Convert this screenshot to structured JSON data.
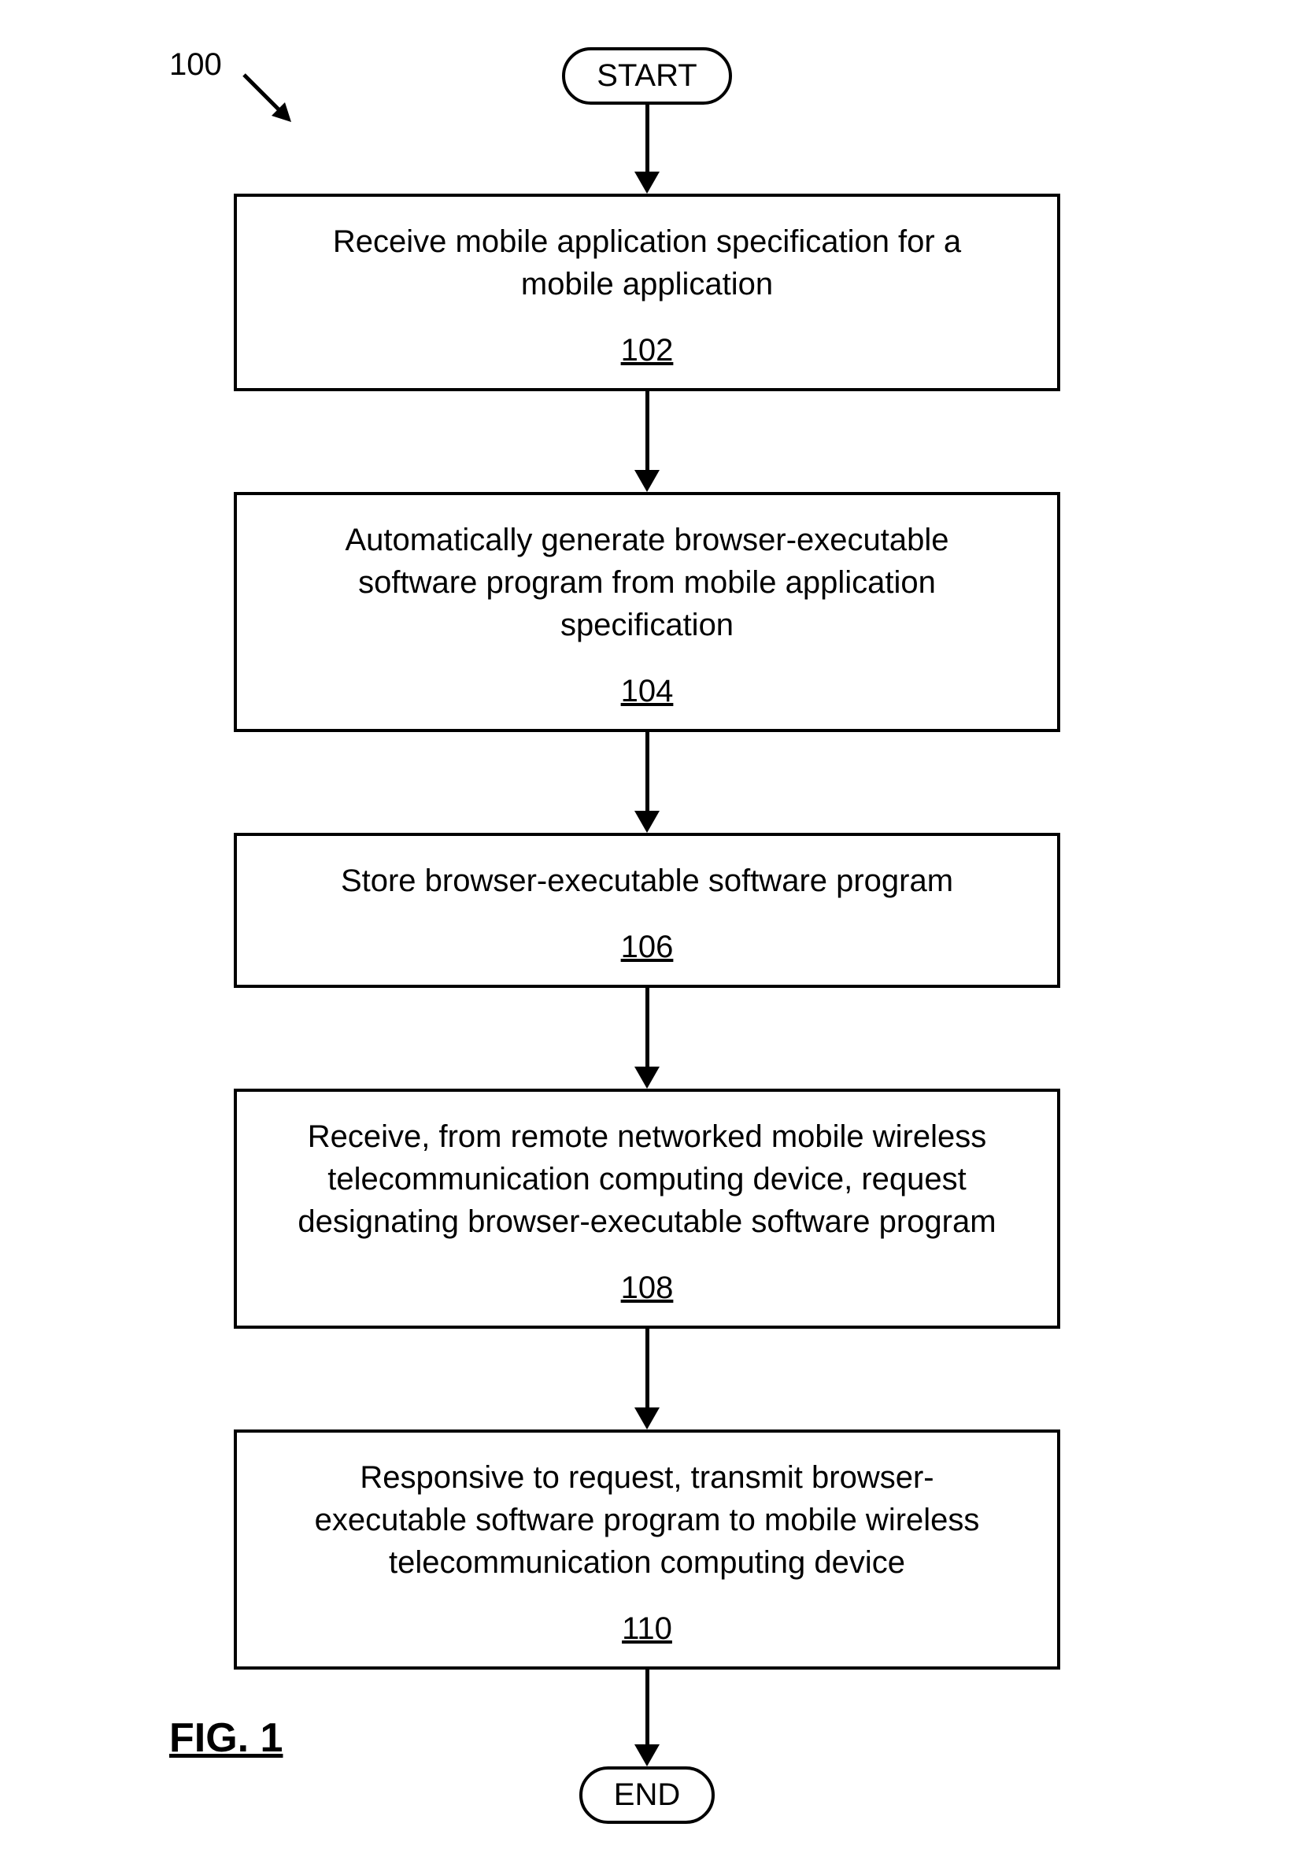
{
  "refNumber": "100",
  "start": "START",
  "end": "END",
  "figLabel": "FIG. 1",
  "steps": [
    {
      "text": "Receive mobile application specification for a mobile application",
      "num": "102"
    },
    {
      "text": "Automatically generate browser-executable software program from mobile application specification",
      "num": "104"
    },
    {
      "text": "Store browser-executable software program",
      "num": "106"
    },
    {
      "text": "Receive, from remote networked mobile wireless telecommunication computing device, request designating browser-executable software program",
      "num": "108"
    },
    {
      "text": "Responsive to request, transmit browser-executable software program to mobile wireless telecommunication computing device",
      "num": "110"
    }
  ],
  "arrowHeights": {
    "startTo1": 85,
    "between": 100,
    "lastToEnd": 95
  }
}
